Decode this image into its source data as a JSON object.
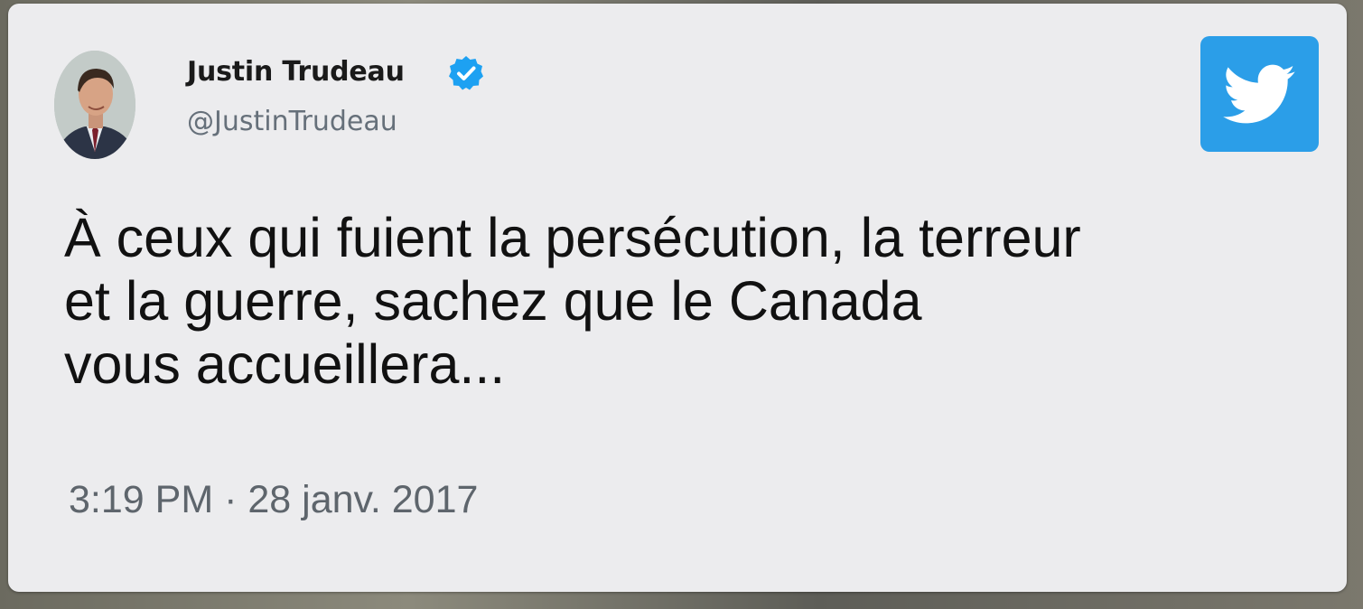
{
  "author": {
    "name": "Justin Trudeau",
    "handle": "@JustinTrudeau",
    "verified": true,
    "avatar_icon": "profile-photo"
  },
  "tweet": {
    "lines": [
      "À ceux qui fuient la persécution, la terreur",
      "et la guerre, sachez que le Canada",
      "vous accueillera..."
    ],
    "time": "3:19 PM",
    "separator": "·",
    "date": "28 janv. 2017"
  },
  "brand": {
    "icon": "twitter-bird-icon",
    "accent": "#2b9ee8",
    "verified_color": "#1da1f2"
  }
}
